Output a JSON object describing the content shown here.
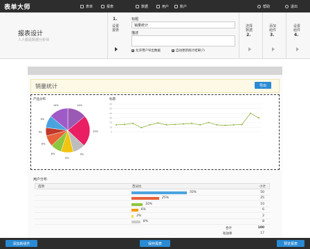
{
  "topbar": {
    "brand": "表单大师",
    "nav": [
      {
        "label": "表单",
        "icon": "table-icon"
      },
      {
        "label": "报表",
        "icon": "chart-icon"
      },
      {
        "label": "数据",
        "icon": "data-icon"
      },
      {
        "label": "用户",
        "icon": "users-icon"
      },
      {
        "label": "账户",
        "icon": "account-icon"
      }
    ],
    "help": "帮助",
    "logout": "退出"
  },
  "header": {
    "title": "报表设计",
    "subtitle": "人人都是数据分析师",
    "step1": {
      "num": "1.",
      "label1": "设置",
      "label2": "报表"
    },
    "form": {
      "title_label": "标题",
      "title_value": "销量统计",
      "desc_label": "描述",
      "desc_value": "",
      "cb1": "允许用户导出数据",
      "cb2": "自动更新统计结果(?)"
    },
    "step2": {
      "num": "2.",
      "label1": "选择",
      "label2": "数据"
    },
    "step3": {
      "num": "3.",
      "label1": "添加",
      "label2": "组件"
    },
    "step4": {
      "num": "4.",
      "label1": "设置",
      "label2": "组件"
    }
  },
  "report": {
    "title": "销量统计",
    "export_label": "导出",
    "pie_title": "产品分布",
    "line_title": "标题",
    "table_title": "用户分布",
    "col_option": "选项",
    "col_percent": "百分比",
    "col_count": "小计",
    "rows": [
      {
        "pct": 0.5,
        "label": "50%",
        "count": "50",
        "color": "#4aa3df"
      },
      {
        "pct": 0.25,
        "label": "25%",
        "count": "25",
        "color": "#e8623a"
      },
      {
        "pct": 0.1,
        "label": "10%",
        "count": "10",
        "color": "#8dc63f"
      },
      {
        "pct": 0.06,
        "label": "6%",
        "count": "6",
        "color": "#f39c12"
      },
      {
        "pct": 0.02,
        "label": "2%",
        "count": "2",
        "color": "#f1e04b"
      },
      {
        "pct": 0.08,
        "label": "8%",
        "count": "8",
        "color": "#cccccc"
      }
    ],
    "total_label": "合计",
    "total_value": "100",
    "valid_label": "有效率",
    "valid_value": "17"
  },
  "chart_data": [
    {
      "type": "pie",
      "title": "产品分布",
      "slices": [
        {
          "label": "14%",
          "value": 14,
          "color": "#9b59b6"
        },
        {
          "label": "23%",
          "value": 23,
          "color": "#e91e63"
        },
        {
          "label": "9%",
          "value": 9,
          "color": "#bdbdbd"
        },
        {
          "label": "9%",
          "value": 9,
          "color": "#f1c40f"
        },
        {
          "label": "8%",
          "value": 8,
          "color": "#8dc63f"
        },
        {
          "label": "8%",
          "value": 8,
          "color": "#e8623a"
        },
        {
          "label": "6%",
          "value": 6,
          "color": "#c0392b"
        },
        {
          "label": "9%",
          "value": 9,
          "color": "#4aa3df"
        },
        {
          "label": "14%",
          "value": 14,
          "color": "#a05ac8"
        }
      ]
    },
    {
      "type": "line",
      "title": "标题",
      "x": [
        1,
        2,
        3,
        4,
        5,
        6,
        7,
        8,
        9,
        10,
        11,
        12,
        13,
        14,
        15,
        16,
        17,
        18
      ],
      "y": [
        15,
        16,
        18,
        9,
        15,
        19,
        15,
        16,
        17,
        18,
        15,
        20,
        15,
        14,
        15,
        16,
        40,
        30
      ],
      "ylim": [
        0,
        60
      ],
      "yticks": [
        "60",
        "50",
        "40",
        "30",
        "20",
        "10",
        "0"
      ],
      "color": "#8fb339"
    }
  ],
  "footer": {
    "add_component": "添加新组件",
    "save_report": "保存报表",
    "preview_report": "预览报表"
  }
}
